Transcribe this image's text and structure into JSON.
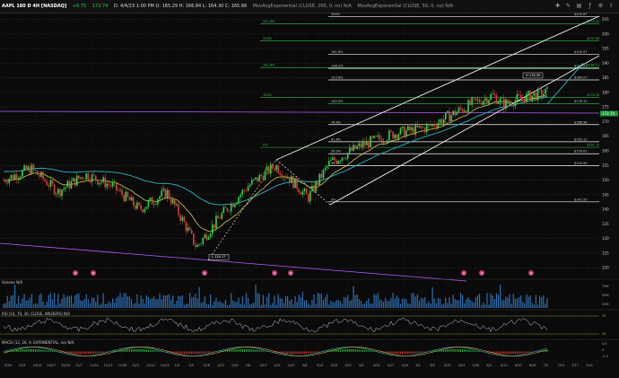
{
  "header": {
    "symbol": "AAPL 180 D 4H [NASDAQ]",
    "price_change": "+0.75",
    "price": "172.74",
    "info": "D: 4/4/23 1:00 PM  O: 165.29  H: 166.84  L: 164.30  C: 165.66",
    "study1": "MovAvgExponential (CLOSE, 200, 0, no) N/A",
    "study2": "MovAvgExponential (CLOSE, 50, 0, no) N/A",
    "toolbar_icons": [
      "crosshair-icon",
      "drawings-icon",
      "style-icon",
      "studies-icon",
      "gear-icon",
      "share-icon"
    ]
  },
  "price_axis": {
    "ticks": [
      "205",
      "200",
      "195",
      "190",
      "185",
      "180",
      "175",
      "170",
      "165",
      "160",
      "155",
      "150",
      "145",
      "140",
      "135",
      "130",
      "125",
      "120"
    ],
    "last_price": "172.74"
  },
  "fib_levels": [
    {
      "pct": "200%",
      "price": "$205.87"
    },
    {
      "pct": "161.8%",
      "price": "$192.97"
    },
    {
      "pct": "138.2%",
      "price": "$188.23"
    },
    {
      "pct": "123.6%",
      "price": "$184.27"
    },
    {
      "pct": "100.0%",
      "price": "$176.15"
    },
    {
      "pct": "78.6%",
      "price": "$168.98"
    },
    {
      "pct": "61.8%",
      "price": "$163.12"
    },
    {
      "pct": "50.0%",
      "price": "$159.01"
    },
    {
      "pct": "38.2%",
      "price": "$154.90"
    },
    {
      "pct": "0%",
      "price": "$142.55"
    }
  ],
  "upper_fibs": [
    {
      "pct": "261.8%",
      "price": "$203.42"
    },
    {
      "pct": "200%",
      "price": "$197.66"
    },
    {
      "pct": "161.8%",
      "price": "$188.51"
    },
    {
      "pct": "100%",
      "price": "$178.26"
    },
    {
      "pct": "0%",
      "price": "$161.19"
    }
  ],
  "annotations": {
    "high_label": "H 176.39",
    "low_label": "L 124.17",
    "dividend_markers": [
      "D",
      "D",
      "D",
      "D",
      "D",
      "D",
      "D",
      "D"
    ]
  },
  "volume": {
    "label": "Volume",
    "value": "N/A",
    "ticks": [
      "75M",
      "50M",
      "25M"
    ]
  },
  "rsi": {
    "label": "RSI (14, 70, 30, CLOSE, WILDERS)",
    "value": "N/A",
    "ticks": [
      "70",
      "30"
    ]
  },
  "macd": {
    "label": "MACD (12, 26, 9, EXPONENTIAL, no)",
    "value": "N/A",
    "ticks": [
      "0.5",
      "0",
      "-0.5"
    ]
  },
  "time_axis": [
    "9/26",
    "10/3",
    "10/10",
    "10/17",
    "10/24",
    "11/7",
    "11/14",
    "11/21",
    "11/28",
    "12/5",
    "12/12",
    "12/19",
    "1/3",
    "1/9",
    "1/16",
    "1/23",
    "1/30",
    "2/6",
    "2/13",
    "2/21",
    "2/27",
    "3/6",
    "3/13",
    "3/20",
    "3/27",
    "4/3",
    "4/10",
    "4/17",
    "4/24",
    "5/1",
    "5/8",
    "5/15",
    "5/22",
    "5/30",
    "6/5",
    "6/12",
    "6/20",
    "6/26",
    "7/3",
    "7/10",
    "7/17",
    "7/24"
  ],
  "colors": {
    "background": "#0a0a0a",
    "candle_up": "#2bd84a",
    "candle_down": "#e23b3b",
    "ema_slow": "#27b8c7",
    "ema_fast": "#d7c94a",
    "fib_green": "#36c24a",
    "fib_white": "#f2f2f2",
    "purple": "#b95cff"
  }
}
